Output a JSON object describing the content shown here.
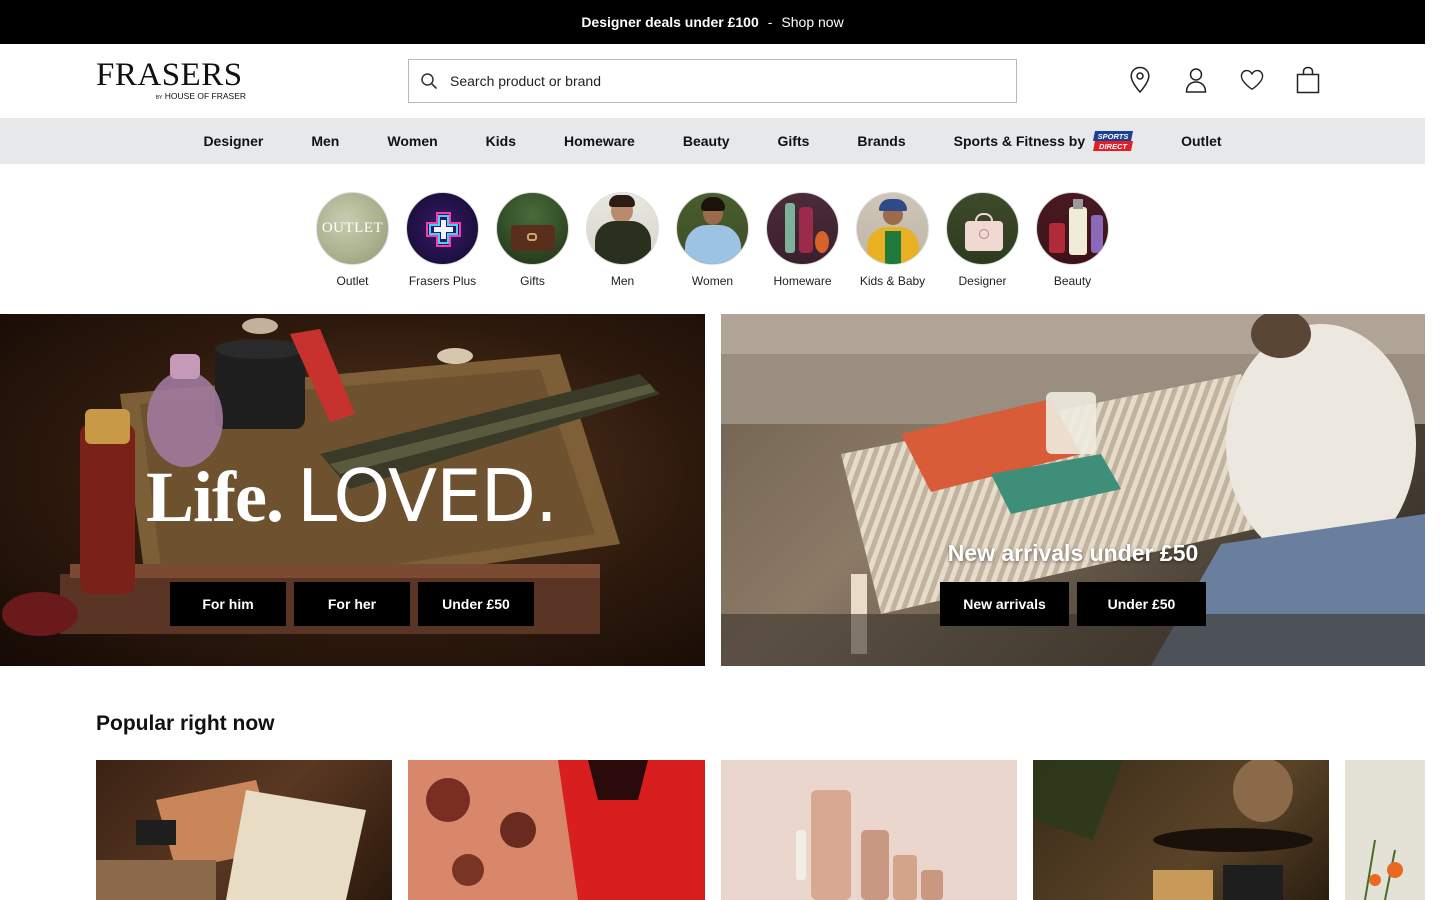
{
  "promo": {
    "text": "Designer deals under £100",
    "separator": "-",
    "link": "Shop now"
  },
  "header": {
    "logo_text": "FRASERS",
    "logo_by": "BY",
    "logo_sub": "HOUSE OF FRASER",
    "search_placeholder": "Search product or brand",
    "icons": [
      "location-pin-icon",
      "account-icon",
      "wishlist-heart-icon",
      "shopping-bag-icon"
    ]
  },
  "nav": {
    "items": [
      "Designer",
      "Men",
      "Women",
      "Kids",
      "Homeware",
      "Beauty",
      "Gifts",
      "Brands",
      "Sports & Fitness by",
      "Outlet"
    ],
    "badge_top": "SPORTS",
    "badge_bottom": "DIRECT"
  },
  "categories": [
    {
      "label": "Outlet",
      "disc_text": "OUTLET"
    },
    {
      "label": "Frasers Plus"
    },
    {
      "label": "Gifts"
    },
    {
      "label": "Men"
    },
    {
      "label": "Women"
    },
    {
      "label": "Homeware"
    },
    {
      "label": "Kids & Baby"
    },
    {
      "label": "Designer"
    },
    {
      "label": "Beauty"
    }
  ],
  "hero_left": {
    "title_part1": "Life.",
    "title_part2": "LOVED.",
    "buttons": [
      "For him",
      "For her",
      "Under £50"
    ]
  },
  "hero_right": {
    "title": "New arrivals under £50",
    "buttons": [
      "New arrivals",
      "Under £50"
    ]
  },
  "popular": {
    "title": "Popular right now"
  },
  "colors": {
    "black": "#000000",
    "nav_bg": "#e6e8ea",
    "sd_blue": "#1c3f94",
    "sd_red": "#e41e26"
  }
}
